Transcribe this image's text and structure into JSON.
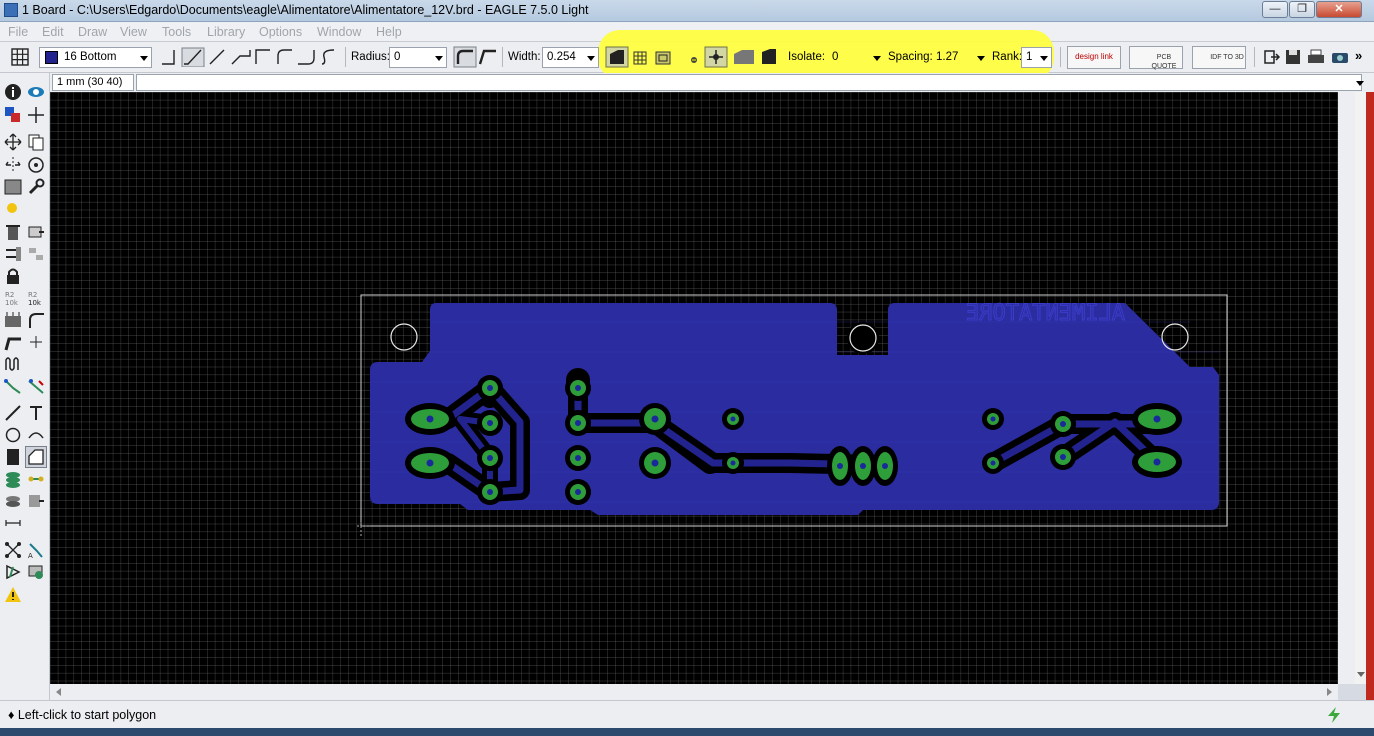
{
  "window": {
    "title": "1 Board - C:\\Users\\Edgardo\\Documents\\eagle\\Alimentatore\\Alimentatore_12V.brd - EAGLE 7.5.0 Light",
    "minimize": "—",
    "maximize": "❐",
    "close": "✕"
  },
  "menu": [
    "File",
    "Edit",
    "Draw",
    "View",
    "Tools",
    "Library",
    "Options",
    "Window",
    "Help"
  ],
  "toolbar": {
    "layer": "16 Bottom",
    "radius_label": "Radius:",
    "radius_value": "0",
    "width_label": "Width:",
    "width_value": "0.254",
    "isolate_label": "Isolate:",
    "isolate_value": "0",
    "spacing_label": "Spacing:",
    "spacing_value": "1.27",
    "rank_label": "Rank:",
    "rank_value": "1",
    "designlink": "design link",
    "pcbquote": "PCB QUOTE",
    "idf": "IDF TO 3D",
    "more": "»"
  },
  "coord": "1 mm (30 40)",
  "board": {
    "label": "ALIMENTATORE",
    "polygon_color": "#2a2ca0",
    "pad_color": "#2e9e3a",
    "outline_color": "#d0d0d0"
  },
  "status": {
    "message": "♦ Left-click to start polygon"
  }
}
